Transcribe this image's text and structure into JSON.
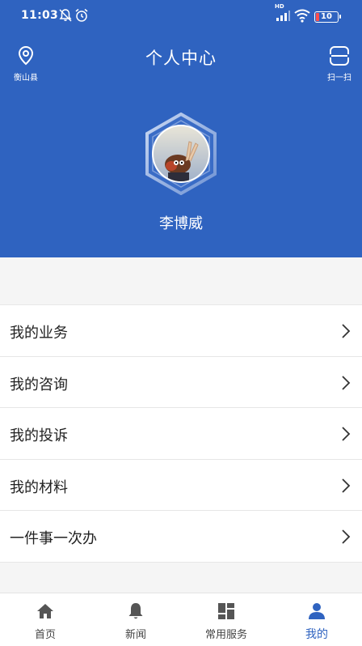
{
  "status_bar": {
    "time": "11:03",
    "battery": "10",
    "network": "HD"
  },
  "header": {
    "title": "个人中心",
    "location_label": "衡山县",
    "scan_label": "扫一扫"
  },
  "profile": {
    "name": "李博威"
  },
  "menu": {
    "items": [
      {
        "label": "我的业务"
      },
      {
        "label": "我的咨询"
      },
      {
        "label": "我的投诉"
      },
      {
        "label": "我的材料"
      },
      {
        "label": "一件事一次办"
      }
    ]
  },
  "tabbar": {
    "tabs": [
      {
        "label": "首页",
        "icon": "home-icon"
      },
      {
        "label": "新闻",
        "icon": "bell-icon"
      },
      {
        "label": "常用服务",
        "icon": "grid-icon"
      },
      {
        "label": "我的",
        "icon": "person-icon"
      }
    ],
    "active_index": 3
  },
  "colors": {
    "brand": "#2f63c0",
    "background": "#f5f5f5",
    "text": "#222222"
  }
}
